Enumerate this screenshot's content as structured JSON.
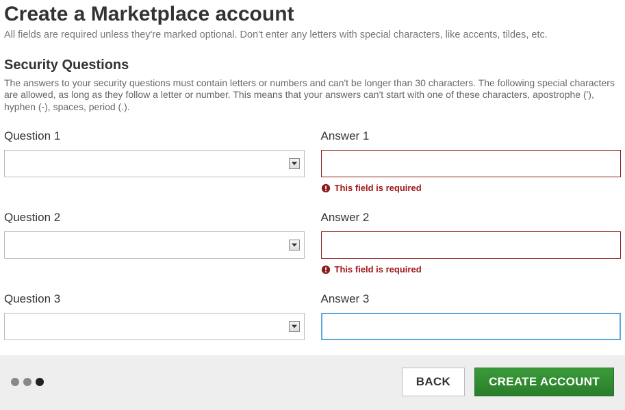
{
  "header": {
    "title": "Create a Marketplace account",
    "subtitle": "All fields are required unless they're marked optional. Don't enter any letters with special characters, like accents, tildes, etc."
  },
  "section": {
    "title": "Security Questions",
    "desc": "The answers to your security questions must contain letters or numbers and can't be longer than 30 characters. The following special characters are allowed, as long as they follow a letter or number. This means that your answers can't start with one of these characters, apostrophe ('), hyphen (-), spaces, period (.)."
  },
  "questions": [
    {
      "qlabel": "Question 1",
      "alabel": "Answer 1",
      "qvalue": "",
      "avalue": "",
      "error": "This field is required",
      "focused": false
    },
    {
      "qlabel": "Question 2",
      "alabel": "Answer 2",
      "qvalue": "",
      "avalue": "",
      "error": "This field is required",
      "focused": false
    },
    {
      "qlabel": "Question 3",
      "alabel": "Answer 3",
      "qvalue": "",
      "avalue": "",
      "error": "",
      "focused": true
    }
  ],
  "footer": {
    "back": "BACK",
    "create": "CREATE ACCOUNT",
    "steps": [
      false,
      false,
      true
    ]
  }
}
